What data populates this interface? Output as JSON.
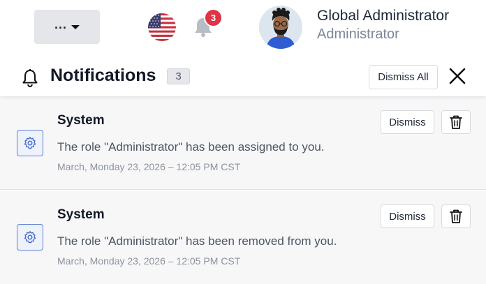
{
  "topbar": {
    "more_label": "...",
    "notification_count": "3",
    "user": {
      "name": "Global Administrator",
      "role": "Administrator"
    }
  },
  "panel": {
    "title": "Notifications",
    "count": "3",
    "dismiss_all_label": "Dismiss All"
  },
  "notifications": [
    {
      "title": "System",
      "message": "The role \"Administrator\" has been assigned to you.",
      "time": "March, Monday 23, 2026 – 12:05 PM CST",
      "dismiss_label": "Dismiss",
      "icon": "gear-icon"
    },
    {
      "title": "System",
      "message": "The role \"Administrator\" has been removed from you.",
      "time": "March, Monday 23, 2026 – 12:05 PM CST",
      "dismiss_label": "Dismiss",
      "icon": "gear-icon"
    }
  ],
  "colors": {
    "badge": "#dc3545",
    "accent": "#5b7fd6",
    "row_bg": "#f7f7f8"
  }
}
